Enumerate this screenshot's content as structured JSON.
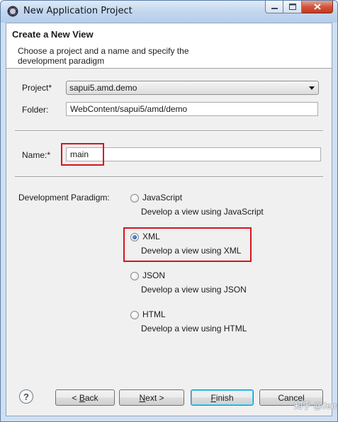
{
  "window": {
    "title": "New Application Project"
  },
  "header": {
    "title": "Create a New View",
    "description": "Choose a project and a name and specify the development paradigm"
  },
  "form": {
    "project_label": "Project",
    "project_value": "sapui5.amd.demo",
    "folder_label": "Folder:",
    "folder_value": "WebContent/sapui5/amd/demo",
    "name_label": "Name:",
    "name_value": "main",
    "required_mark": "*"
  },
  "paradigm": {
    "label": "Development Paradigm:",
    "options": [
      {
        "name": "JavaScript",
        "desc": "Develop a view using JavaScript",
        "selected": false
      },
      {
        "name": "XML",
        "desc": "Develop a view using XML",
        "selected": true
      },
      {
        "name": "JSON",
        "desc": "Develop a view using JSON",
        "selected": false
      },
      {
        "name": "HTML",
        "desc": "Develop a view using HTML",
        "selected": false
      }
    ]
  },
  "buttons": {
    "back": {
      "mnemonic": "B",
      "rest": "ack",
      "prefix": "< "
    },
    "next": {
      "mnemonic": "N",
      "rest": "ext",
      "suffix": " >"
    },
    "finish": {
      "mnemonic": "F",
      "rest": "inish"
    },
    "cancel": "Cancel",
    "help": "?"
  },
  "watermark": "知乎 @JerryWang",
  "colors": {
    "highlight": "#d8141e",
    "title_bar": "#c3d7ee"
  }
}
